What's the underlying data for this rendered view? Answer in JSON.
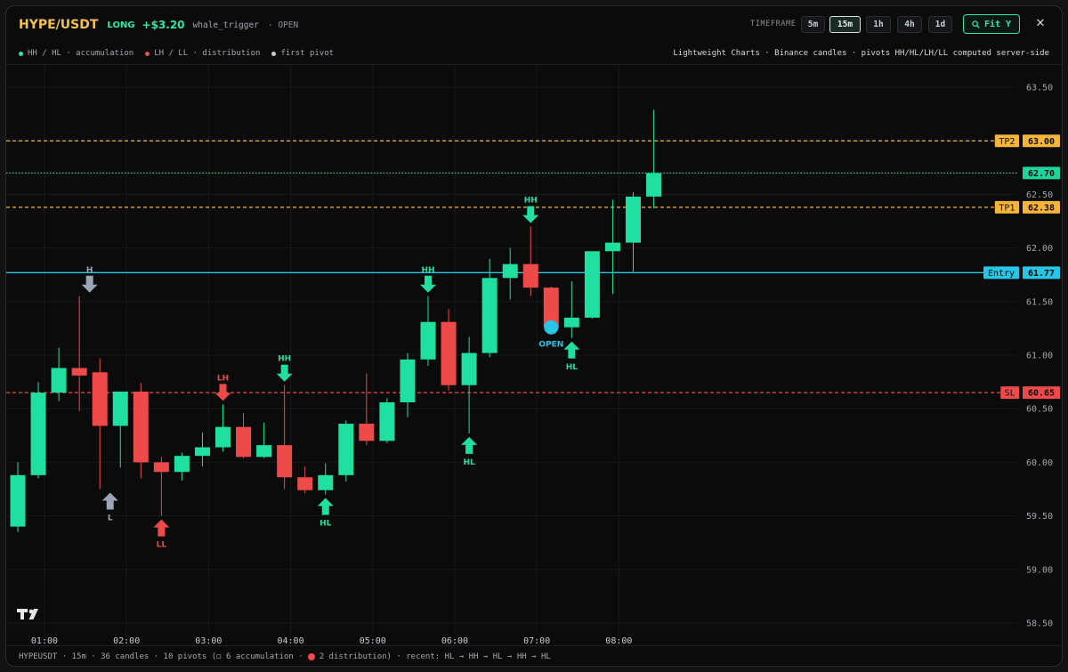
{
  "header": {
    "symbol": "HYPE/USDT",
    "side": "LONG",
    "pnl": "+$3.20",
    "trigger": "whale_trigger",
    "status": "· OPEN",
    "timeframe_label": "TIMEFRAME",
    "timeframes": [
      "5m",
      "15m",
      "1h",
      "4h",
      "1d"
    ],
    "active_timeframe": "15m",
    "fit_label": "Fit Y",
    "close_label": "✕"
  },
  "legend": {
    "items": [
      {
        "label": "HH / HL · accumulation",
        "color": "#2ee6a6"
      },
      {
        "label": "LH / LL · distribution",
        "color": "#ef4a4a"
      },
      {
        "label": "first pivot",
        "color": "#c9ccd1"
      }
    ],
    "source": "Lightweight Charts · Binance candles · pivots HH/HL/LH/LL computed server-side"
  },
  "footer": {
    "text_before": "HYPEUSDT · 15m · 36 candles · 10 pivots (◻ 6 accumulation ·",
    "text_after": "2 distribution) · recent: HL → HH → HL → HH → HL"
  },
  "chart_data": {
    "type": "candlestick",
    "ylim": [
      58.4,
      63.7
    ],
    "y_ticks": [
      58.5,
      59.0,
      59.5,
      60.0,
      60.5,
      61.0,
      61.5,
      62.0,
      62.5,
      63.0,
      63.5
    ],
    "y_tick_labels": [
      "58.50",
      "59.00",
      "59.50",
      "60.00",
      "60.50",
      "61.00",
      "61.50",
      "62.00",
      "62.50",
      "63.00",
      "63.50"
    ],
    "x_tick_labels": [
      {
        "index": 1.3,
        "label": "01:00"
      },
      {
        "index": 5.3,
        "label": "02:00"
      },
      {
        "index": 9.3,
        "label": "03:00"
      },
      {
        "index": 13.3,
        "label": "04:00"
      },
      {
        "index": 17.3,
        "label": "05:00"
      },
      {
        "index": 21.3,
        "label": "06:00"
      },
      {
        "index": 25.3,
        "label": "07:00"
      },
      {
        "index": 29.3,
        "label": "08:00"
      }
    ],
    "candles": [
      {
        "o": 59.4,
        "h": 60.0,
        "l": 59.35,
        "c": 59.88
      },
      {
        "o": 59.88,
        "h": 60.75,
        "l": 59.85,
        "c": 60.65
      },
      {
        "o": 60.65,
        "h": 61.07,
        "l": 60.57,
        "c": 60.88
      },
      {
        "o": 60.88,
        "h": 61.55,
        "l": 60.48,
        "c": 60.81
      },
      {
        "o": 60.84,
        "h": 60.97,
        "l": 59.75,
        "c": 60.34
      },
      {
        "o": 60.34,
        "h": 60.65,
        "l": 59.95,
        "c": 60.66
      },
      {
        "o": 60.66,
        "h": 60.74,
        "l": 59.85,
        "c": 60.0
      },
      {
        "o": 60.0,
        "h": 60.05,
        "l": 59.5,
        "c": 59.91
      },
      {
        "o": 59.91,
        "h": 60.09,
        "l": 59.83,
        "c": 60.06
      },
      {
        "o": 60.06,
        "h": 60.28,
        "l": 59.96,
        "c": 60.14
      },
      {
        "o": 60.14,
        "h": 60.54,
        "l": 60.1,
        "c": 60.33
      },
      {
        "o": 60.33,
        "h": 60.46,
        "l": 60.04,
        "c": 60.05
      },
      {
        "o": 60.05,
        "h": 60.37,
        "l": 60.04,
        "c": 60.16
      },
      {
        "o": 60.16,
        "h": 60.72,
        "l": 59.75,
        "c": 59.86
      },
      {
        "o": 59.86,
        "h": 59.96,
        "l": 59.71,
        "c": 59.74
      },
      {
        "o": 59.74,
        "h": 59.99,
        "l": 59.7,
        "c": 59.88
      },
      {
        "o": 59.88,
        "h": 60.39,
        "l": 59.82,
        "c": 60.36
      },
      {
        "o": 60.36,
        "h": 60.83,
        "l": 60.16,
        "c": 60.2
      },
      {
        "o": 60.2,
        "h": 60.6,
        "l": 60.18,
        "c": 60.56
      },
      {
        "o": 60.56,
        "h": 61.02,
        "l": 60.42,
        "c": 60.96
      },
      {
        "o": 60.96,
        "h": 61.55,
        "l": 60.9,
        "c": 61.31
      },
      {
        "o": 61.31,
        "h": 61.43,
        "l": 60.67,
        "c": 60.72
      },
      {
        "o": 60.72,
        "h": 61.17,
        "l": 60.27,
        "c": 61.02
      },
      {
        "o": 61.02,
        "h": 61.9,
        "l": 60.98,
        "c": 61.72
      },
      {
        "o": 61.72,
        "h": 62.0,
        "l": 61.52,
        "c": 61.85
      },
      {
        "o": 61.85,
        "h": 62.2,
        "l": 61.55,
        "c": 61.63
      },
      {
        "o": 61.63,
        "h": 61.64,
        "l": 61.27,
        "c": 61.26
      },
      {
        "o": 61.26,
        "h": 61.69,
        "l": 61.16,
        "c": 61.35
      },
      {
        "o": 61.35,
        "h": 61.95,
        "l": 61.34,
        "c": 61.97
      },
      {
        "o": 61.97,
        "h": 62.45,
        "l": 61.57,
        "c": 62.05
      },
      {
        "o": 62.05,
        "h": 62.52,
        "l": 61.78,
        "c": 62.48
      },
      {
        "o": 62.48,
        "h": 63.29,
        "l": 62.37,
        "c": 62.7
      }
    ],
    "price_lines": [
      {
        "label": "TP2",
        "value": 63.0,
        "value_label": "63.00",
        "color": "#f5b53a",
        "style": "dashed",
        "label_on_left": true
      },
      {
        "label": "",
        "value": 62.7,
        "value_label": "62.70",
        "color": "#1fd49a",
        "style": "dotted",
        "label_on_left": false
      },
      {
        "label": "TP1",
        "value": 62.38,
        "value_label": "62.38",
        "color": "#f5b53a",
        "style": "dashed",
        "label_on_left": true
      },
      {
        "label": "Entry",
        "value": 61.77,
        "value_label": "61.77",
        "color": "#27c5e6",
        "style": "solid",
        "label_on_left": true
      },
      {
        "label": "SL",
        "value": 60.65,
        "value_label": "60.65",
        "color": "#ef4a4a",
        "style": "dashed",
        "label_on_left": true
      }
    ],
    "pivots": [
      {
        "index": 3.5,
        "label": "H",
        "position": "above",
        "kind": "first"
      },
      {
        "index": 4.5,
        "label": "L",
        "position": "below",
        "kind": "first"
      },
      {
        "index": 7,
        "label": "LL",
        "position": "below",
        "kind": "distribution"
      },
      {
        "index": 10,
        "label": "LH",
        "position": "above",
        "kind": "distribution"
      },
      {
        "index": 13,
        "label": "HH",
        "position": "above",
        "kind": "accumulation"
      },
      {
        "index": 15,
        "label": "HL",
        "position": "below",
        "kind": "accumulation"
      },
      {
        "index": 20,
        "label": "HH",
        "position": "above",
        "kind": "accumulation"
      },
      {
        "index": 22,
        "label": "HL",
        "position": "below",
        "kind": "accumulation"
      },
      {
        "index": 25,
        "label": "HH",
        "position": "above",
        "kind": "accumulation"
      },
      {
        "index": 27,
        "label": "HL",
        "position": "below",
        "kind": "accumulation"
      }
    ],
    "markers": [
      {
        "index": 26,
        "price": 61.26,
        "label": "OPEN",
        "color": "#27c5e6"
      }
    ],
    "colors": {
      "up": "#1fe0a0",
      "down": "#ef4a4a",
      "first": "#9aa4b8"
    }
  }
}
